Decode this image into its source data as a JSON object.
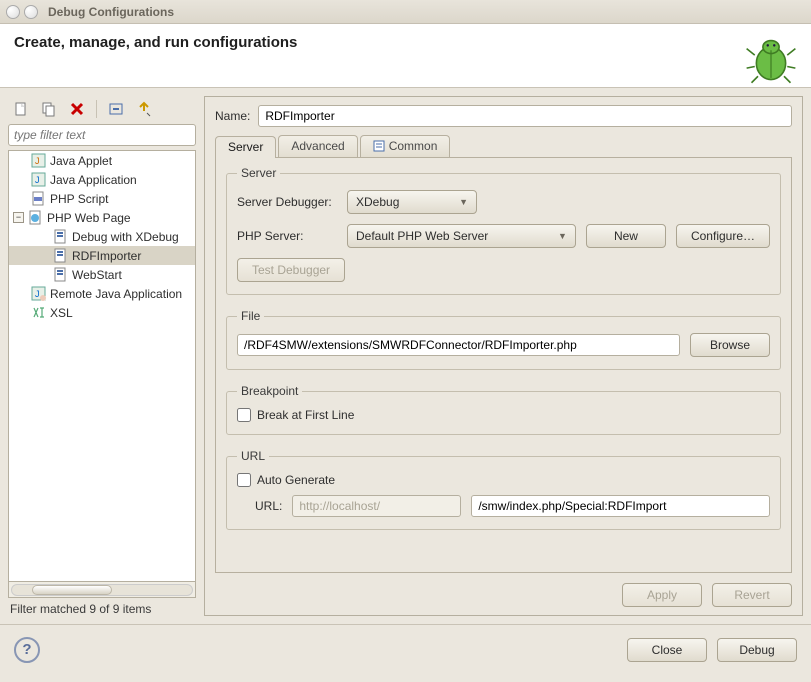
{
  "window": {
    "title": "Debug Configurations"
  },
  "header": {
    "title": "Create, manage, and run configurations"
  },
  "filter": {
    "placeholder": "type filter text",
    "status": "Filter matched 9 of 9 items"
  },
  "tree": {
    "items": [
      {
        "label": "Java Applet"
      },
      {
        "label": "Java Application"
      },
      {
        "label": "PHP Script"
      },
      {
        "label": "PHP Web Page",
        "children": [
          {
            "label": "Debug with XDebug"
          },
          {
            "label": "RDFImporter"
          },
          {
            "label": "WebStart"
          }
        ]
      },
      {
        "label": "Remote Java Application"
      },
      {
        "label": "XSL"
      }
    ]
  },
  "name": {
    "label": "Name:",
    "value": "RDFImporter"
  },
  "tabs": {
    "server": "Server",
    "advanced": "Advanced",
    "common": "Common"
  },
  "server": {
    "legend": "Server",
    "debuggerLabel": "Server Debugger:",
    "debuggerValue": "XDebug",
    "phpServerLabel": "PHP Server:",
    "phpServerValue": "Default PHP Web Server",
    "newBtn": "New",
    "configureBtn": "Configure…",
    "testBtn": "Test Debugger"
  },
  "file": {
    "legend": "File",
    "value": "/RDF4SMW/extensions/SMWRDFConnector/RDFImporter.php",
    "browseBtn": "Browse"
  },
  "breakpoint": {
    "legend": "Breakpoint",
    "check": "Break at First Line"
  },
  "url": {
    "legend": "URL",
    "autoGen": "Auto Generate",
    "label": "URL:",
    "host": "http://localhost/",
    "path": "/smw/index.php/Special:RDFImport"
  },
  "actions": {
    "apply": "Apply",
    "revert": "Revert",
    "close": "Close",
    "debug": "Debug"
  }
}
